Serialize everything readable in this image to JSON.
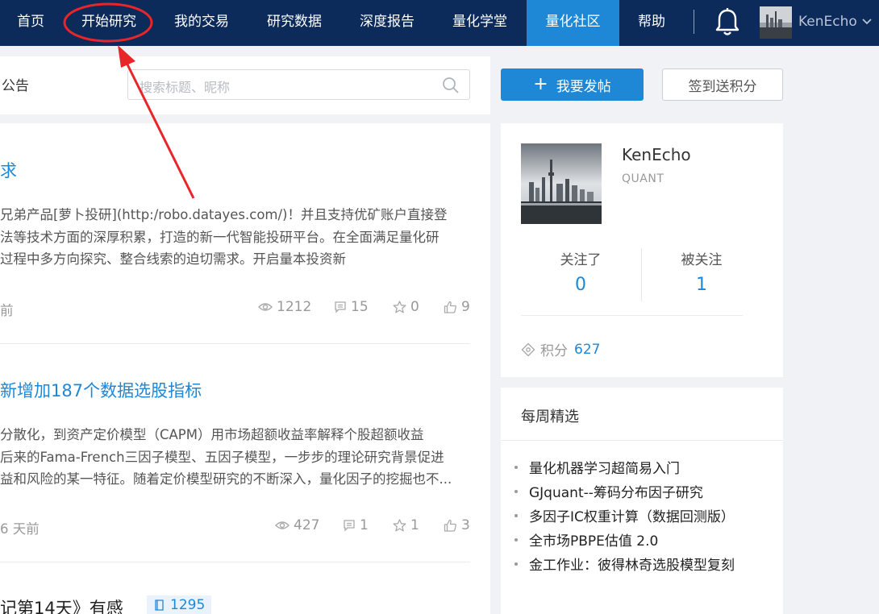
{
  "nav": {
    "items": [
      {
        "label": "首页"
      },
      {
        "label": "开始研究"
      },
      {
        "label": "我的交易"
      },
      {
        "label": "研究数据"
      },
      {
        "label": "深度报告"
      },
      {
        "label": "量化学堂"
      },
      {
        "label": "量化社区",
        "active": true
      },
      {
        "label": "帮助"
      }
    ],
    "username": "KenEcho"
  },
  "search": {
    "tab_label": "公告",
    "placeholder": "搜索标题、昵称"
  },
  "actions": {
    "new_post": "我要发帖",
    "sign_in": "签到送积分"
  },
  "posts": [
    {
      "title": "求",
      "excerpt": [
        "兄弟产品[萝卜投研](http:/robo.datayes.com/)！并且支持优矿账户直接登",
        "法等技术方面的深厚积累，打造的新一代智能投研平台。在全面满足量化研",
        "过程中多方向探究、整合线索的迫切需求。开启量本投资新"
      ],
      "time": "前",
      "views": "1212",
      "comments": "15",
      "stars": "0",
      "likes": "9"
    },
    {
      "title": "新增加187个数据选股指标",
      "excerpt": [
        "分散化，到资产定价模型（CAPM）用市场超额收益率解释个股超额收益",
        "后来的Fama-French三因子模型、五因子模型，一步步的理论研究背景促进",
        "益和风险的某一特征。随着定价模型研究的不断深入，量化因子的挖掘也不..."
      ],
      "time": "6 天前",
      "views": "427",
      "comments": "1",
      "stars": "1",
      "likes": "3"
    },
    {
      "title": "记第14天》有感",
      "views": "1295"
    }
  ],
  "profile": {
    "name": "KenEcho",
    "role": "QUANT",
    "following_label": "关注了",
    "following": "0",
    "followers_label": "被关注",
    "followers": "1",
    "points_label": "积分",
    "points": "627"
  },
  "weekly": {
    "title": "每周精选",
    "items": [
      "量化机器学习超简易入门",
      "GJquant--筹码分布因子研究",
      "多因子IC权重计算（数据回测版）",
      "全市场PBPE估值 2.0",
      "金工作业：彼得林奇选股模型复刻"
    ]
  },
  "colors": {
    "nav_bg": "#0c2a5a",
    "accent": "#1e88d6",
    "annotation": "#e8262a"
  }
}
